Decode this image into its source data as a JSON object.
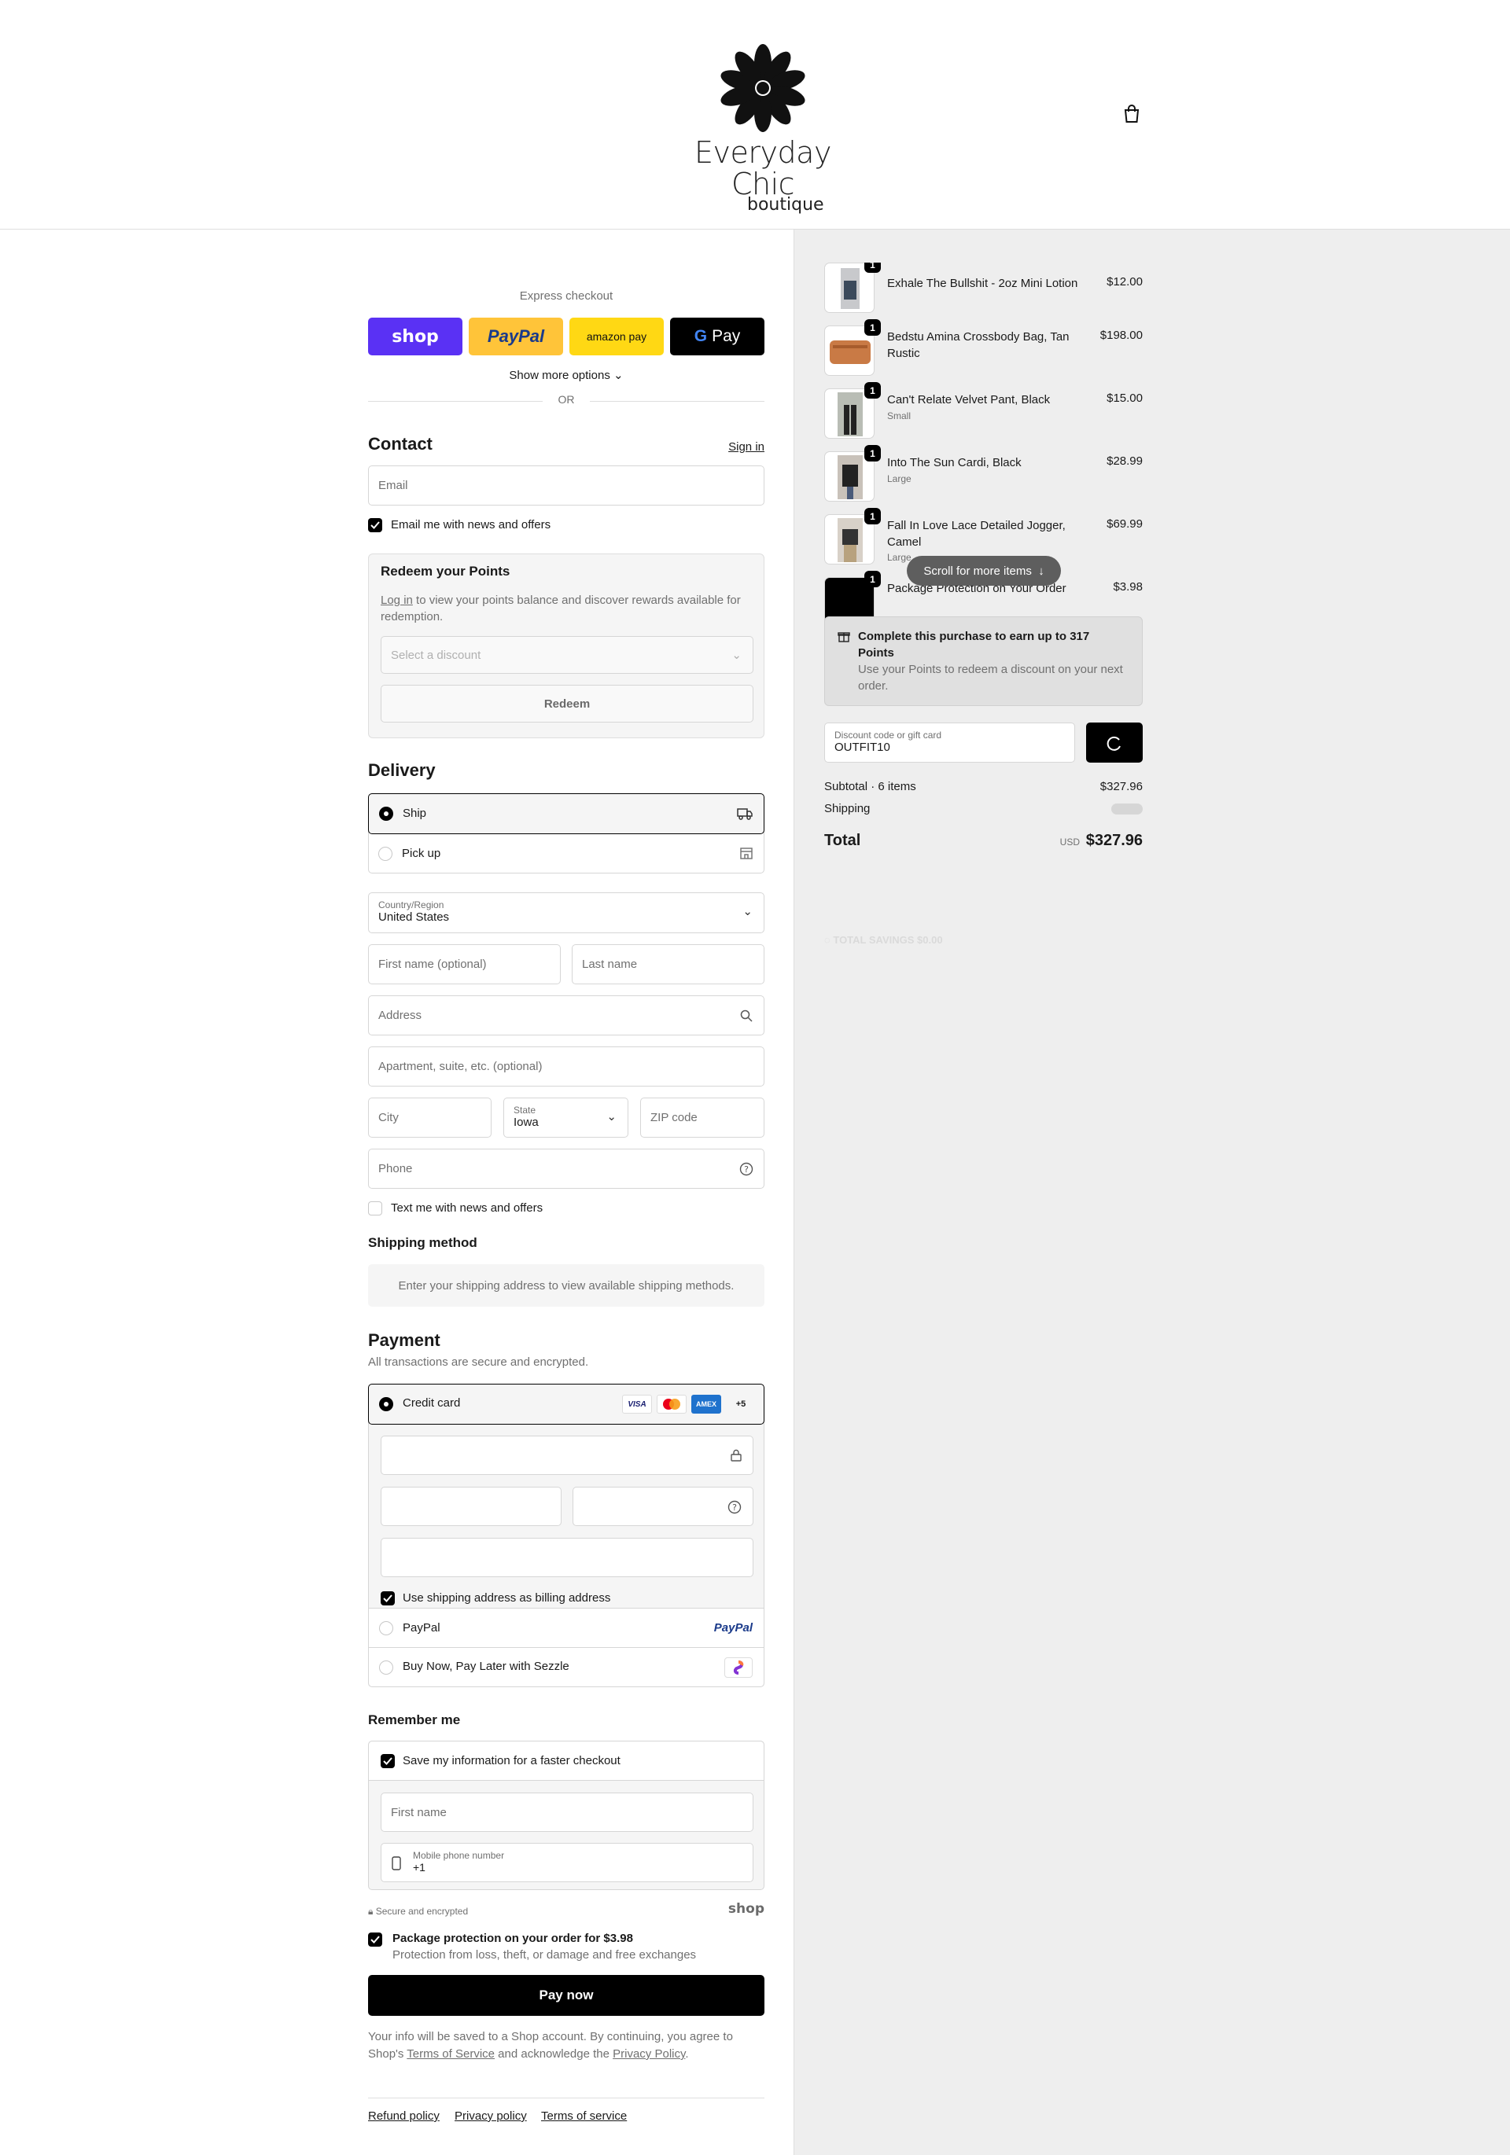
{
  "brand": {
    "line1": "Everyday Chic",
    "line2": "boutique"
  },
  "express": {
    "title": "Express checkout",
    "shop_label": "shop",
    "paypal_label": "PayPal",
    "amazon_label": "amazon pay",
    "gpay_label": "Pay",
    "more_options": "Show more options",
    "or": "OR"
  },
  "contact": {
    "title": "Contact",
    "sign_in": "Sign in",
    "email_placeholder": "Email",
    "news_label": "Email me with news and offers"
  },
  "points": {
    "title": "Redeem your Points",
    "login_link": "Log in",
    "desc": " to view your points balance and discover rewards available for redemption.",
    "select_placeholder": "Select a discount",
    "redeem_label": "Redeem"
  },
  "delivery": {
    "title": "Delivery",
    "ship_label": "Ship",
    "pickup_label": "Pick up",
    "country_label": "Country/Region",
    "country_value": "United States",
    "first_name_placeholder": "First name (optional)",
    "last_name_placeholder": "Last name",
    "address_placeholder": "Address",
    "apartment_placeholder": "Apartment, suite, etc. (optional)",
    "city_placeholder": "City",
    "state_label": "State",
    "state_value": "Iowa",
    "zip_placeholder": "ZIP code",
    "phone_placeholder": "Phone",
    "text_news_label": "Text me with news and offers"
  },
  "shipping_method": {
    "title": "Shipping method",
    "notice": "Enter your shipping address to view available shipping methods."
  },
  "payment": {
    "title": "Payment",
    "subtitle": "All transactions are secure and encrypted.",
    "credit_card_label": "Credit card",
    "card_brands": [
      "VISA",
      "mc",
      "AMEX"
    ],
    "more_brands": "+5",
    "billing_label": "Use shipping address as billing address",
    "paypal_label": "PayPal",
    "paypal_logo": "PayPal",
    "sezzle_label": "Buy Now, Pay Later with Sezzle"
  },
  "remember": {
    "title": "Remember me",
    "save_label": "Save my information for a faster checkout",
    "first_name_placeholder": "First name",
    "mobile_label": "Mobile phone number",
    "mobile_value": "+1",
    "secure_label": "Secure and encrypted",
    "shop_logo": "shop"
  },
  "protection": {
    "title": "Package protection on your order for $3.98",
    "desc": "Protection from loss, theft, or damage and free exchanges"
  },
  "pay_now": "Pay now",
  "legal": {
    "part1": "Your info will be saved to a Shop account. By continuing, you agree to Shop's ",
    "tos": "Terms of Service",
    "part2": " and acknowledge the ",
    "privacy": "Privacy Policy",
    "part3": "."
  },
  "footer_links": [
    "Refund policy",
    "Privacy policy",
    "Terms of service"
  ],
  "order": {
    "items": [
      {
        "qty": "1",
        "name": "Exhale The Bullshit - 2oz Mini Lotion",
        "variant": "",
        "price": "$12.00"
      },
      {
        "qty": "1",
        "name": "Bedstu Amina Crossbody Bag, Tan Rustic",
        "variant": "",
        "price": "$198.00"
      },
      {
        "qty": "1",
        "name": "Can't Relate Velvet Pant, Black",
        "variant": "Small",
        "price": "$15.00"
      },
      {
        "qty": "1",
        "name": "Into The Sun Cardi, Black",
        "variant": "Large",
        "price": "$28.99"
      },
      {
        "qty": "1",
        "name": "Fall In Love Lace Detailed Jogger, Camel",
        "variant": "Large",
        "price": "$69.99"
      },
      {
        "qty": "1",
        "name": "Package Protection on Your Order",
        "variant": "",
        "price": "$3.98"
      }
    ],
    "scroll_hint": "Scroll for more items",
    "earn_title": "Complete this purchase to earn up to 317 Points",
    "earn_desc": "Use your Points to redeem a discount on your next order.",
    "discount_label": "Discount code or gift card",
    "discount_value": "OUTFIT10",
    "subtotal_label": "Subtotal · 6 items",
    "subtotal_value": "$327.96",
    "shipping_label": "Shipping",
    "total_label": "Total",
    "currency": "USD",
    "total_value": "$327.96",
    "savings_label": "TOTAL SAVINGS",
    "savings_value": "$0.00"
  },
  "colors": {
    "shop": "#5a31f4",
    "paypal": "#ffc439",
    "dark": "#000000",
    "panel": "#eeeeee"
  }
}
